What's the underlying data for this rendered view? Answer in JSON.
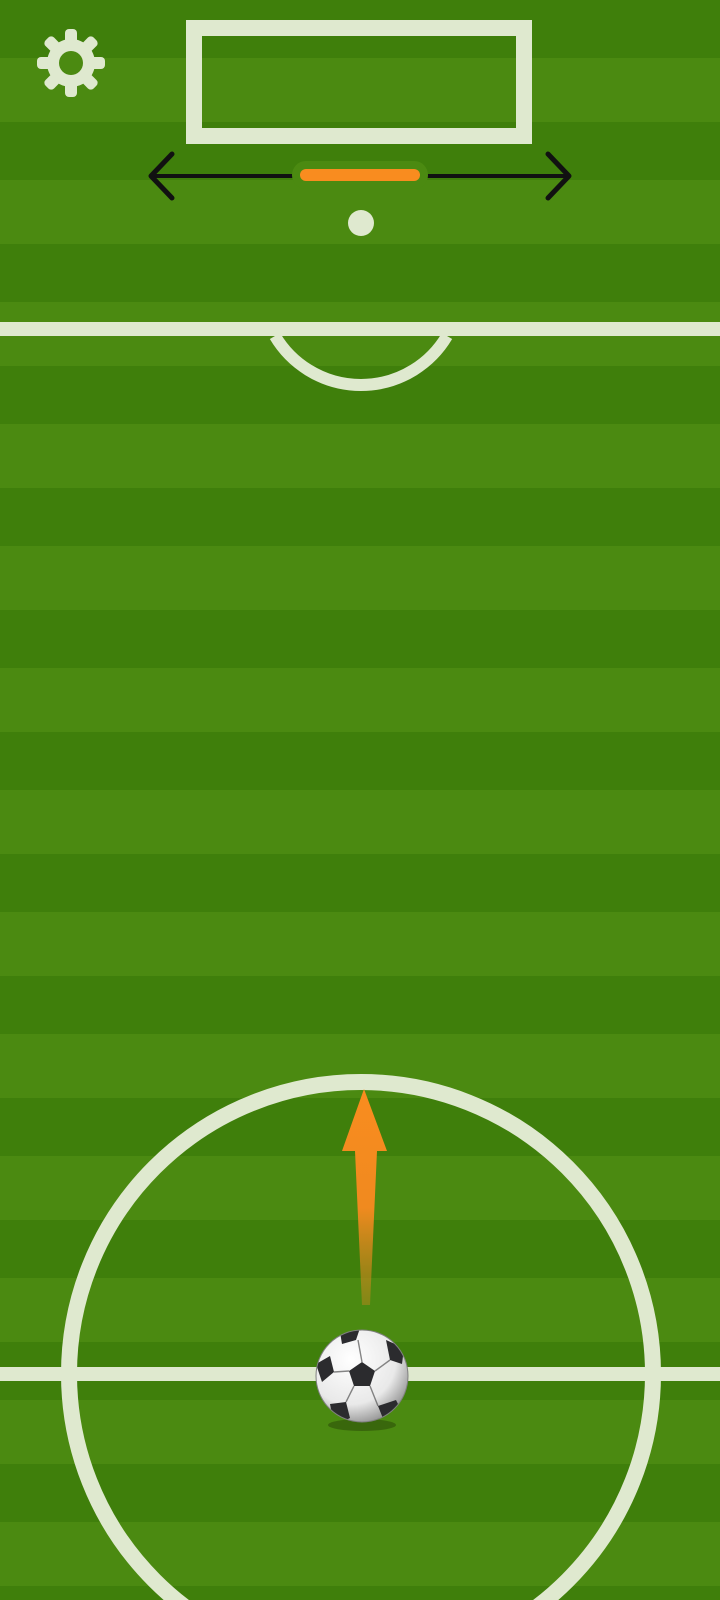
{
  "colors": {
    "grass_dark": "#3f7f0b",
    "grass_light": "#4b8a11",
    "field_lines": "#dfe9cf",
    "accent": "#f98c1f",
    "arrow_black": "#111111"
  },
  "controls": {
    "settings_icon": "gear-icon",
    "aim_slider_position": 0.5,
    "shoot_direction": "up"
  },
  "icons": {
    "settings": "gear-icon",
    "aim_left": "arrow-left-icon",
    "aim_right": "arrow-right-icon",
    "shoot": "arrow-up-icon",
    "ball": "soccer-ball-icon"
  }
}
